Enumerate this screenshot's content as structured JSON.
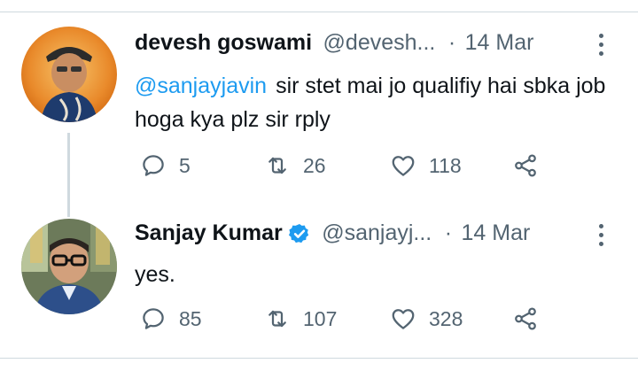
{
  "tweets": [
    {
      "author_name": "devesh goswami",
      "handle": "@devesh...",
      "separator": "·",
      "date": "14 Mar",
      "mention": "@sanjayjavin",
      "text": "sir stet mai jo qualifiy hai sbka job hoga kya plz sir rply",
      "replies": "5",
      "retweets": "26",
      "likes": "118",
      "verified": false
    },
    {
      "author_name": "Sanjay Kumar",
      "handle": "@sanjayj...",
      "separator": "·",
      "date": "14 Mar",
      "mention": "",
      "text": "yes.",
      "replies": "85",
      "retweets": "107",
      "likes": "328",
      "verified": true
    }
  ],
  "colors": {
    "accent": "#1d9bf0",
    "secondary_text": "#536471",
    "divider": "#cfd9de"
  },
  "icons": [
    "reply-icon",
    "retweet-icon",
    "like-icon",
    "share-icon",
    "more-options-icon",
    "verified-badge-icon"
  ]
}
